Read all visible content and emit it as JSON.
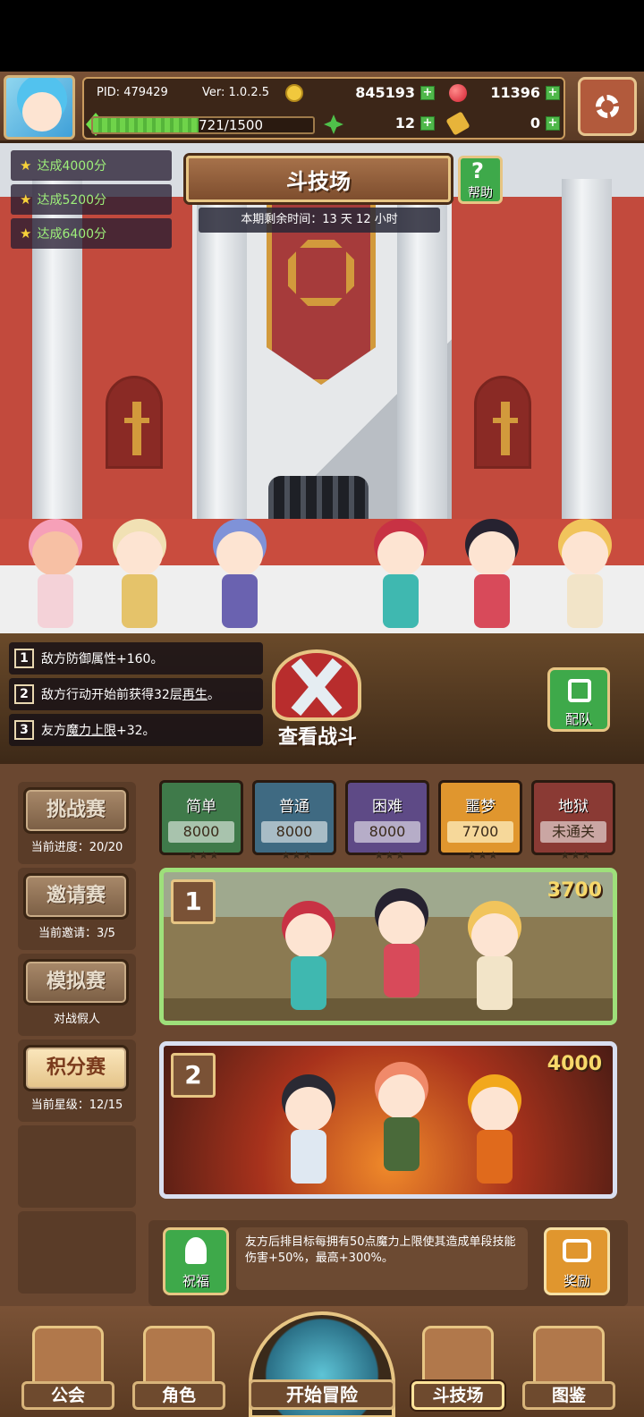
{
  "hud": {
    "pid": "PID: 479429",
    "version": "Ver: 1.0.2.5",
    "gold": "845193",
    "gems": "11396",
    "xp": "721/1500",
    "xp_fraction": 0.48,
    "clover": "12",
    "keys": "0",
    "plus_symbol": "+"
  },
  "arena": {
    "title": "斗技场",
    "help_label": "帮助",
    "help_symbol": "?",
    "timer": "本期剩余时间：13 天 12 小时",
    "goals": [
      "达成4000分",
      "达成5200分",
      "达成6400分"
    ],
    "star_symbol": "★"
  },
  "buffs": {
    "items": [
      {
        "num": "1",
        "text": "敌方防御属性+160。"
      },
      {
        "num": "2",
        "text_pre": "敌方行动开始前获得32层",
        "text_link": "再生",
        "text_post": "。"
      },
      {
        "num": "3",
        "text_pre": "友方",
        "text_link": "魔力上限",
        "text_post": "+32。"
      }
    ],
    "watch_label": "查看战斗",
    "team_label": "配队"
  },
  "modes": [
    {
      "label": "挑战赛",
      "sub": "当前进度：20/20",
      "active": false
    },
    {
      "label": "邀请赛",
      "sub": "当前邀请：3/5",
      "active": false
    },
    {
      "label": "模拟赛",
      "sub": "对战假人",
      "active": false
    },
    {
      "label": "积分赛",
      "sub": "当前星级：12/15",
      "active": true
    }
  ],
  "difficulties": [
    {
      "name": "简单",
      "score": "8000",
      "stars": "★★★",
      "color": "#3f7a4a"
    },
    {
      "name": "普通",
      "score": "8000",
      "stars": "★★★",
      "color": "#3f6a82"
    },
    {
      "name": "困难",
      "score": "8000",
      "stars": "★★★",
      "color": "#5e4a86"
    },
    {
      "name": "噩梦",
      "score": "7700",
      "stars": "★★★",
      "color": "#e0962e"
    },
    {
      "name": "地狱",
      "score": "未通关",
      "stars": "★★★",
      "color": "#8a3a34"
    }
  ],
  "opponents": [
    {
      "rank": "1",
      "points": "3700"
    },
    {
      "rank": "2",
      "points": "4000"
    }
  ],
  "blessing": {
    "label": "祝福",
    "text": "友方后排目标每拥有50点魔力上限使其造成单段技能伤害+50%，最高+300%。",
    "reward_label": "奖励"
  },
  "nav": {
    "guild": "公会",
    "characters": "角色",
    "adventure": "开始冒险",
    "arena": "斗技场",
    "codex": "图鉴"
  },
  "colors": {
    "accent_gold": "#e7c583",
    "green_button": "#3ea94a",
    "orange_button": "#e0962e"
  }
}
